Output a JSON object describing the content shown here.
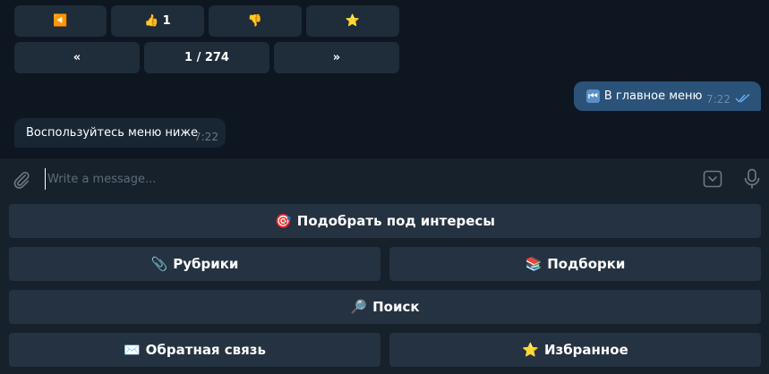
{
  "inline_keyboard": {
    "row1": [
      {
        "icon": "◀️",
        "label": "",
        "icon_name": "back-arrow-icon"
      },
      {
        "icon": "👍",
        "label": "1",
        "icon_name": "thumbs-up-icon"
      },
      {
        "icon": "👎",
        "label": "",
        "icon_name": "thumbs-down-icon"
      },
      {
        "icon": "⭐",
        "label": "",
        "icon_name": "star-icon"
      }
    ],
    "row2": [
      {
        "label": "«"
      },
      {
        "label": "1 / 274"
      },
      {
        "label": "»"
      }
    ]
  },
  "messages": [
    {
      "direction": "out",
      "icon": "⏮",
      "text": "В главное меню",
      "time": "7:22",
      "status": "read"
    },
    {
      "direction": "in",
      "text": "Воспользуйтесь меню ниже",
      "time": "7:22"
    }
  ],
  "composer": {
    "placeholder": "Write a message..."
  },
  "reply_keyboard": [
    {
      "icon": "🎯",
      "label": "Подобрать под интересы"
    },
    {
      "icon": "📎",
      "label": "Рубрики"
    },
    {
      "icon": "📚",
      "label": "Подборки"
    },
    {
      "icon": "🔎",
      "label": "Поиск"
    },
    {
      "icon": "✉️",
      "label": "Обратная связь"
    },
    {
      "icon": "⭐",
      "label": "Избранное"
    }
  ],
  "colors": {
    "chat_bg": "#0e1621",
    "outgoing_bubble": "#2b5278",
    "incoming_bubble": "#182533",
    "panel": "#17212b",
    "button": "#253241",
    "read_check": "#64b4ef"
  }
}
